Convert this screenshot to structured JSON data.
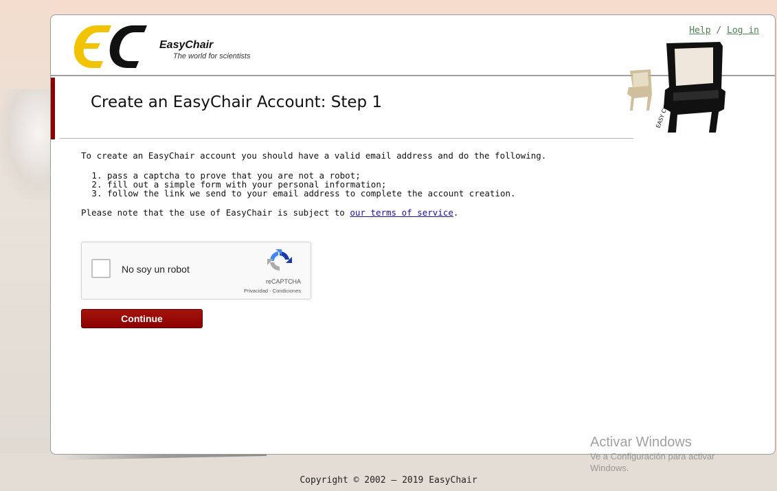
{
  "header": {
    "logo_name": "EasyChair",
    "logo_tagline": "The world for scientists",
    "help_link": "Help",
    "links_separator": "/",
    "login_link": "Log in"
  },
  "page": {
    "title": "Create an EasyChair Account: Step 1",
    "intro": "To create an EasyChair account you should have a valid email address and do the following.",
    "steps": [
      "pass a captcha to prove that you are not a robot;",
      "fill out a simple form with your personal information;",
      "follow the link we send to your email address to complete the account creation."
    ],
    "note_prefix": "Please note that the use of EasyChair is subject to ",
    "terms_link": "our terms of service",
    "note_suffix": "."
  },
  "recaptcha": {
    "label": "No soy un robot",
    "brand": "reCAPTCHA",
    "privacy_link": "Privacidad",
    "separator": " - ",
    "terms_link": "Condiciones",
    "checked": false
  },
  "form": {
    "continue_label": "Continue"
  },
  "footer": {
    "copyright": "Copyright © 2002 – 2019 EasyChair"
  },
  "watermark": {
    "title": "Activar Windows",
    "subtitle": "Ve a Configuración para activar",
    "subtitle2": "Windows."
  },
  "colors": {
    "brand_red": "#8b0000",
    "link_green": "#4d8050",
    "link_blue": "#1a0dab",
    "page_bg": "#f6dccc",
    "logo_yellow": "#f2c300"
  },
  "icons": [
    "easychair-logo",
    "chair-illustration",
    "recaptcha-logo-icon"
  ]
}
